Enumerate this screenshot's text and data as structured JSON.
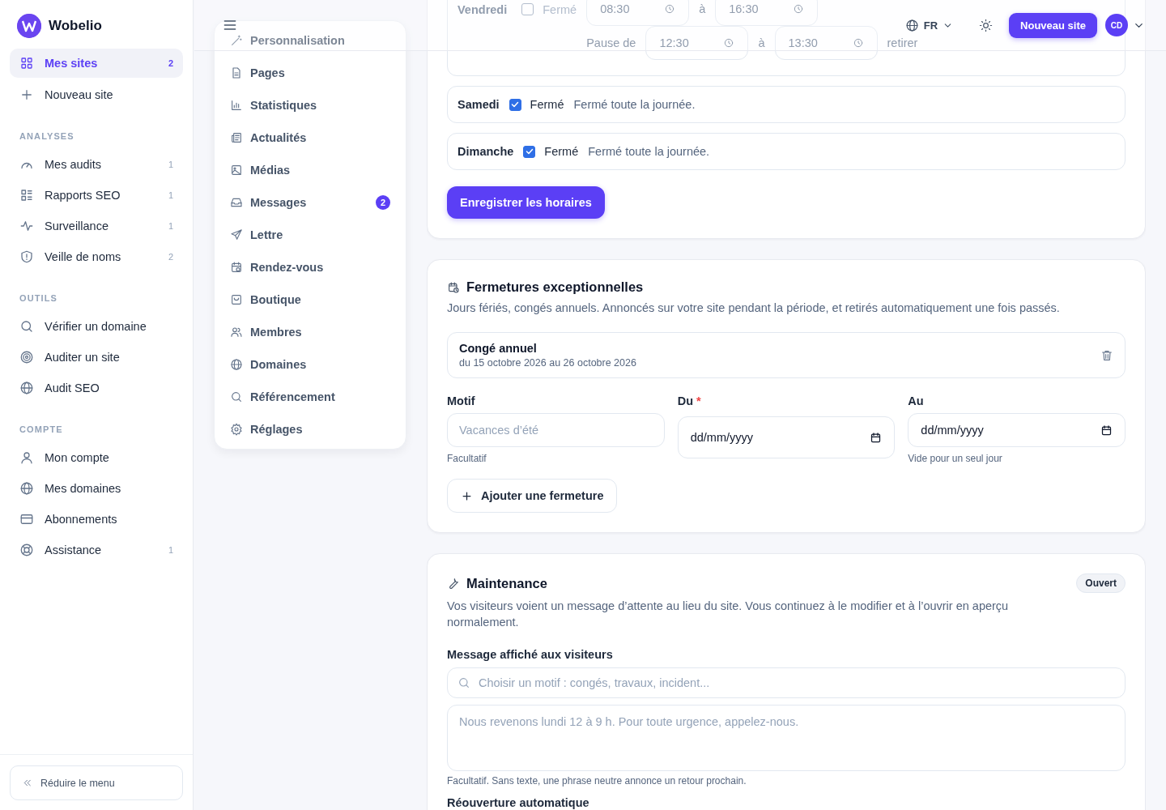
{
  "brand": {
    "name": "Wobelio"
  },
  "sidebar": {
    "top_items": [
      {
        "label": "Mes sites",
        "count": "2",
        "selected": true
      },
      {
        "label": "Nouveau site",
        "selected": false
      }
    ],
    "sections": [
      {
        "title": "ANALYSES",
        "items": [
          {
            "label": "Mes audits",
            "count": "1",
            "selected": false
          },
          {
            "label": "Rapports SEO",
            "count": "1",
            "selected": false
          },
          {
            "label": "Surveillance",
            "count": "1",
            "selected": false
          },
          {
            "label": "Veille de noms",
            "count": "2",
            "selected": false
          }
        ]
      },
      {
        "title": "OUTILS",
        "items": [
          {
            "label": "Vérifier un domaine",
            "selected": false
          },
          {
            "label": "Auditer un site",
            "selected": false
          },
          {
            "label": "Audit SEO",
            "selected": false
          }
        ]
      },
      {
        "title": "COMPTE",
        "items": [
          {
            "label": "Mon compte",
            "selected": false
          },
          {
            "label": "Mes domaines",
            "selected": false
          },
          {
            "label": "Abonnements",
            "selected": false
          },
          {
            "label": "Assistance",
            "count": "1",
            "selected": false
          }
        ]
      }
    ],
    "collapse_button": "Réduire le menu"
  },
  "header": {
    "language": "FR",
    "new_site_button": "Nouveau site",
    "avatar_initials": "CD"
  },
  "site_menu": {
    "items": [
      {
        "label": "Personnalisation"
      },
      {
        "label": "Pages"
      },
      {
        "label": "Statistiques"
      },
      {
        "label": "Actualités"
      },
      {
        "label": "Médias"
      },
      {
        "label": "Messages",
        "badge": "2"
      },
      {
        "label": "Lettre"
      },
      {
        "label": "Rendez-vous"
      },
      {
        "label": "Boutique"
      },
      {
        "label": "Membres"
      },
      {
        "label": "Domaines"
      },
      {
        "label": "Référencement"
      },
      {
        "label": "Réglages"
      }
    ]
  },
  "opening_hours": {
    "days": [
      {
        "day": "Vendredi",
        "closed": false,
        "closed_label": "Fermé",
        "open_from": "08:30",
        "to_label": "à",
        "open_to": "16:30",
        "pause_label": "Pause de",
        "pause_from": "12:30",
        "pause_to_label": "à",
        "pause_to": "13:30",
        "remove_label": "retirer"
      },
      {
        "day": "Samedi",
        "closed": true,
        "closed_label": "Fermé",
        "closed_note": "Fermé toute la journée."
      },
      {
        "day": "Dimanche",
        "closed": true,
        "closed_label": "Fermé",
        "closed_note": "Fermé toute la journée."
      }
    ],
    "save_button": "Enregistrer les horaires"
  },
  "exceptional_closures": {
    "title": "Fermetures exceptionnelles",
    "description": "Jours fériés, congés annuels. Annoncés sur votre site pendant la période, et retirés automatiquement une fois passés.",
    "entries": [
      {
        "title": "Congé annuel",
        "dates": "du 15 octobre 2026 au 26 octobre 2026"
      }
    ],
    "reason": {
      "label": "Motif",
      "placeholder": "Vacances d’été",
      "hint": "Facultatif"
    },
    "from": {
      "label": "Du",
      "required_mark": "*",
      "placeholder": "dd/mm/yyyy"
    },
    "to": {
      "label": "Au",
      "placeholder": "dd/mm/yyyy",
      "hint": "Vide pour un seul jour"
    },
    "add_button": "Ajouter une fermeture"
  },
  "maintenance": {
    "title": "Maintenance",
    "status": "Ouvert",
    "description": "Vos visiteurs voient un message d’attente au lieu du site. Vous continuez à le modifier et à l’ouvrir en aperçu normalement.",
    "message_label": "Message affiché aux visiteurs",
    "reason_placeholder": "Choisir un motif : congés, travaux, incident...",
    "message_placeholder": "Nous revenons lundi 12 à 9 h. Pour toute urgence, appelez-nous.",
    "hint": "Facultatif. Sans texte, une phrase neutre annonce un retour prochain.",
    "next_label": "Réouverture automatique"
  }
}
